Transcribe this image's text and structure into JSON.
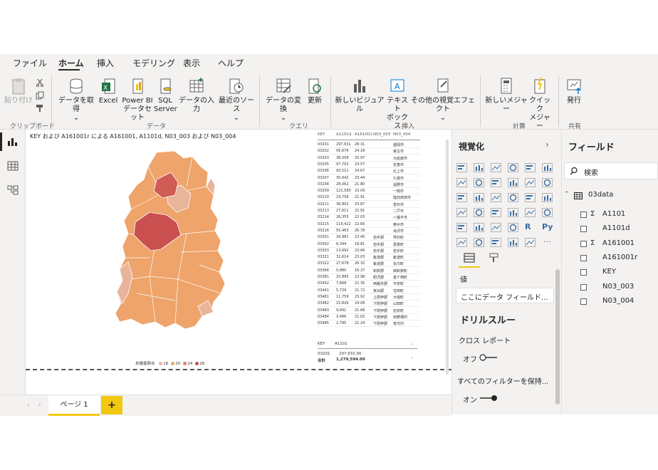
{
  "menu": [
    "ファイル",
    "ホーム",
    "挿入",
    "モデリング",
    "表示",
    "ヘルプ"
  ],
  "ribbon": {
    "paste": "貼り付け",
    "get_data": "データを取得",
    "excel": "Excel",
    "powerbi_l1": "Power BI",
    "powerbi_l2": "データセット",
    "sql_l1": "SQL",
    "sql_l2": "Server",
    "enter_data": "データの入力",
    "recent_sources": "最近のソース",
    "transform": "データの変換",
    "refresh": "更新",
    "new_visual": "新しいビジュアル",
    "textbox_l1": "テキスト",
    "textbox_l2": "ボックス",
    "more_visuals": "その他の視覚エフェクト",
    "new_measure": "新しいメジャー",
    "quick_measure_l1": "クイック",
    "quick_measure_l2": "メジャー",
    "publish": "発行",
    "groups": {
      "clipboard": "クリップボード",
      "data": "データ",
      "query": "クエリ",
      "insert": "挿入",
      "calc": "計算",
      "share": "共有"
    }
  },
  "canvas": {
    "map_title": "KEY および A161001r による A161001, A1101d, N03_003 および N03_004",
    "legend_title": "未婚者割合",
    "legend_items": [
      {
        "label": "16",
        "color": "#e8b49a"
      },
      {
        "label": "20",
        "color": "#eea46a"
      },
      {
        "label": "24",
        "color": "#d9826d"
      },
      {
        "label": "28",
        "color": "#c9504f"
      }
    ],
    "table": {
      "headers": [
        "KEY",
        "A1101d",
        "A161001",
        "N03_003",
        "N03_004"
      ],
      "rows": [
        [
          "03201",
          "297,631",
          "28.31",
          "",
          "盛岡市"
        ],
        [
          "03202",
          "56,676",
          "24.18",
          "",
          "宮古市"
        ],
        [
          "03203",
          "38,058",
          "20.97",
          "",
          "大船渡市"
        ],
        [
          "03205",
          "97,702",
          "23.57",
          "",
          "花巻市"
        ],
        [
          "03206",
          "93,511",
          "24.67",
          "",
          "北上市"
        ],
        [
          "03207",
          "35,642",
          "23.44",
          "",
          "久慈市"
        ],
        [
          "03208",
          "28,062",
          "21.80",
          "",
          "遠野市"
        ],
        [
          "03209",
          "121,583",
          "23.09",
          "",
          "一関市"
        ],
        [
          "03210",
          "19,758",
          "21.91",
          "",
          "陸前高田市"
        ],
        [
          "03211",
          "36,802",
          "23.87",
          "",
          "釜石市"
        ],
        [
          "03213",
          "27,611",
          "22.91",
          "",
          "二戸市"
        ],
        [
          "03214",
          "26,355",
          "22.03",
          "",
          "八幡平市"
        ],
        [
          "03215",
          "119,422",
          "22.66",
          "",
          "奥州市"
        ],
        [
          "03216",
          "55,463",
          "26.78",
          "",
          "滝沢市"
        ],
        [
          "03301",
          "16,981",
          "23.45",
          "岩手郡",
          "雫石町"
        ],
        [
          "03302",
          "6,344",
          "18.81",
          "岩手郡",
          "葛巻町"
        ],
        [
          "03303",
          "13,692",
          "23.66",
          "岩手郡",
          "岩手町"
        ],
        [
          "03321",
          "32,614",
          "23.03",
          "紫波郡",
          "紫波町"
        ],
        [
          "03322",
          "27,678",
          "26.32",
          "紫波郡",
          "矢巾町"
        ],
        [
          "03366",
          "5,880",
          "16.37",
          "和賀郡",
          "西和賀町"
        ],
        [
          "03381",
          "15,895",
          "23.98",
          "胆沢郡",
          "金ケ崎町"
        ],
        [
          "03402",
          "7,868",
          "22.35",
          "西磐井郡",
          "平泉町"
        ],
        [
          "03441",
          "5,729",
          "21.72",
          "気仙郡",
          "住田町"
        ],
        [
          "03461",
          "11,759",
          "23.92",
          "上閉伊郡",
          "大槌町"
        ],
        [
          "03482",
          "15,826",
          "24.08",
          "下閉伊郡",
          "山田町"
        ],
        [
          "03483",
          "9,841",
          "21.68",
          "下閉伊郡",
          "岩泉町"
        ],
        [
          "03484",
          "3,466",
          "21.02",
          "下閉伊郡",
          "田野畑村"
        ],
        [
          "03485",
          "2,795",
          "21.24",
          "下閉伊郡",
          "普代村"
        ]
      ]
    },
    "table2": {
      "headers": [
        "KEY",
        "A1101"
      ],
      "row": [
        "03201",
        "297,631.00"
      ],
      "total_label": "合計",
      "total_value": "1,279,594.00"
    }
  },
  "pages": {
    "tab": "ページ 1",
    "add": "+"
  },
  "viz": {
    "title": "視覚化",
    "values_label": "値",
    "field_placeholder": "ここにデータ フィールド...",
    "drill_title": "ドリルスルー",
    "cross_report": "クロス レポート",
    "off_label": "オフ",
    "keep_filters": "すべてのフィルターを保持...",
    "on_label": "オン",
    "more": "...",
    "r_label": "R",
    "py_label": "Py"
  },
  "fields": {
    "title": "フィールド",
    "search_placeholder": "検索",
    "table_name": "03data",
    "items": [
      {
        "label": "A1101",
        "sigma": true
      },
      {
        "label": "A1101d",
        "sigma": false
      },
      {
        "label": "A161001",
        "sigma": true
      },
      {
        "label": "A161001r",
        "sigma": false
      },
      {
        "label": "KEY",
        "sigma": false
      },
      {
        "label": "N03_003",
        "sigma": false
      },
      {
        "label": "N03_004",
        "sigma": false
      }
    ],
    "sigma": "Σ"
  },
  "colors": {
    "accent": "#f2c811",
    "map_base": "#eea46a",
    "map_light": "#e8b49a",
    "map_dark": "#c9504f",
    "map_mid": "#d9826d"
  }
}
